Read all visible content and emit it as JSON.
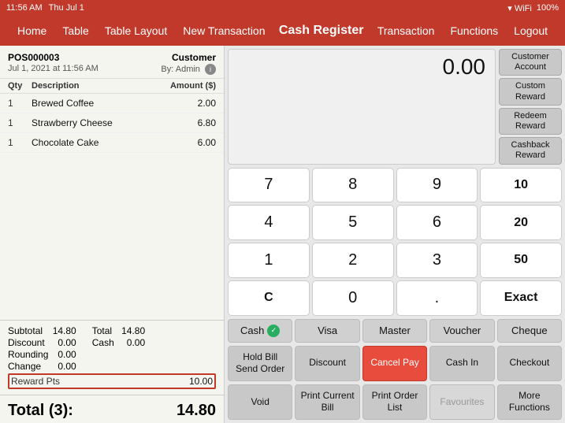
{
  "statusBar": {
    "time": "11:56 AM",
    "day": "Thu Jul 1",
    "wifi": "WiFi",
    "battery": "100%"
  },
  "navBar": {
    "items": [
      "Home",
      "Table",
      "Table Layout",
      "New Transaction"
    ],
    "title": "Cash Register",
    "rightItems": [
      "Transaction",
      "Functions",
      "Logout"
    ]
  },
  "order": {
    "posNumber": "POS000003",
    "date": "Jul 1, 2021 at 11:56 AM",
    "customerLabel": "Customer",
    "customerValue": "By: Admin",
    "colQty": "Qty",
    "colDesc": "Description",
    "colAmount": "Amount ($)",
    "items": [
      {
        "qty": "1",
        "name": "Brewed Coffee",
        "amount": "2.00"
      },
      {
        "qty": "1",
        "name": "Strawberry Cheese",
        "amount": "6.80"
      },
      {
        "qty": "1",
        "name": "Chocolate Cake",
        "amount": "6.00"
      }
    ],
    "subtotalLabel": "Subtotal",
    "subtotalValue": "14.80",
    "totalLabel": "Total",
    "totalValue": "14.80",
    "discountLabel": "Discount",
    "discountValue": "0.00",
    "cashLabel": "Cash",
    "cashValue": "0.00",
    "roundingLabel": "Rounding",
    "roundingValue": "0.00",
    "changeLabel": "Change",
    "changeValue": "0.00",
    "rewardLabel": "Reward Pts",
    "rewardValue": "10.00",
    "grandTotalLabel": "Total (3):",
    "grandTotalValue": "14.80"
  },
  "display": {
    "value": "0.00"
  },
  "rightActions": [
    {
      "label": "Customer\nAccount"
    },
    {
      "label": "Custom\nReward"
    },
    {
      "label": "Redeem\nReward"
    },
    {
      "label": "Cashback\nReward"
    }
  ],
  "numpad": [
    "7",
    "8",
    "9",
    "10",
    "4",
    "5",
    "6",
    "20",
    "1",
    "2",
    "3",
    "50",
    "C",
    "0",
    ".",
    "Exact"
  ],
  "paymentMethods": [
    "Cash",
    "Visa",
    "Master",
    "Voucher",
    "Cheque"
  ],
  "actionRow1": [
    {
      "label": "Hold Bill\nSend Order",
      "style": "normal"
    },
    {
      "label": "Discount",
      "style": "normal"
    },
    {
      "label": "Cancel Pay",
      "style": "red"
    },
    {
      "label": "Cash In",
      "style": "normal"
    },
    {
      "label": "Checkout",
      "style": "normal"
    }
  ],
  "actionRow2": [
    {
      "label": "Void",
      "style": "normal"
    },
    {
      "label": "Print Current Bill",
      "style": "normal"
    },
    {
      "label": "Print Order List",
      "style": "normal"
    },
    {
      "label": "Favourites",
      "style": "disabled"
    },
    {
      "label": "More Functions",
      "style": "normal"
    }
  ]
}
